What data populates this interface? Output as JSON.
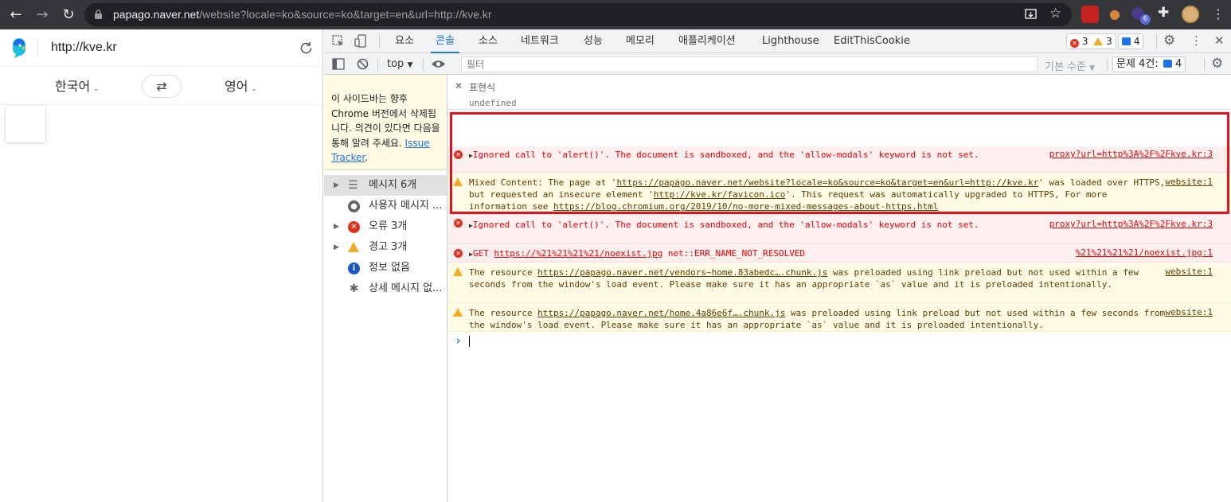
{
  "browser": {
    "url_host": "papago.naver.net",
    "url_path": "/website?locale=ko&source=ko&target=en&url=http://kve.kr",
    "extension_badge": "6"
  },
  "papago": {
    "url": "http://kve.kr",
    "source_lang": "한국어",
    "target_lang": "영어"
  },
  "devtools": {
    "tabs": [
      "요소",
      "콘솔",
      "소스",
      "네트워크",
      "성능",
      "메모리",
      "애플리케이션",
      "Lighthouse",
      "EditThisCookie"
    ],
    "active_tab": "콘솔",
    "counts": {
      "errors": "3",
      "warnings": "3",
      "messages": "4"
    },
    "toolbar": {
      "context": "top",
      "filter_placeholder": "필터",
      "level": "기본 수준",
      "issues_label": "문제 4건:",
      "issues_count": "4"
    },
    "deprecation": {
      "text": "이 사이드바는 향후 Chrome 버전에서 삭제됩니다. 의견이 있다면 다음을 통해 알려 주세요. ",
      "link": "Issue Tracker",
      "suffix": "."
    },
    "sidebar": [
      {
        "label": "메시지 6개",
        "icon": "list-icon"
      },
      {
        "label": "사용자 메시지 ...",
        "icon": "user-icon"
      },
      {
        "label": "오류 3개",
        "icon": "error-icon"
      },
      {
        "label": "경고 3개",
        "icon": "warning-icon"
      },
      {
        "label": "정보 없음",
        "icon": "info-icon"
      },
      {
        "label": "상세 메시지 없...",
        "icon": "bug-icon"
      }
    ],
    "expression": {
      "label": "표현식",
      "value": "undefined"
    },
    "messages": [
      {
        "level": "error",
        "text": "Ignored call to 'alert()'. The document is sandboxed, and the 'allow-modals' keyword is not set.",
        "source": "proxy?url=http%3A%2F%2Fkve.kr:3"
      },
      {
        "level": "warn",
        "text_a": "Mixed Content: The page at '",
        "link_a": "https://papago.naver.net/website?locale=ko&source=ko&target=en&url=http://kve.kr",
        "text_b": "' was loaded over HTTPS, but requested an insecure element '",
        "link_b": "http://kve.kr/favicon.ico",
        "text_c": "'. This request was automatically upgraded to HTTPS, For more information see ",
        "link_c": "https://blog.chromium.org/2019/10/no-more-mixed-messages-about-https.html",
        "source": "website:1"
      },
      {
        "level": "error",
        "text": "Ignored call to 'alert()'. The document is sandboxed, and the 'allow-modals' keyword is not set.",
        "source": "proxy?url=http%3A%2F%2Fkve.kr:3"
      },
      {
        "level": "error",
        "text_a": "GET ",
        "link_a": "https://%21%21%21%21/noexist.jpg",
        "text_b": " net::ERR_NAME_NOT_RESOLVED",
        "source": "%21%21%21%21/noexist.jpg:1"
      },
      {
        "level": "warn",
        "text_a": "The resource ",
        "link_a": "https://papago.naver.net/vendors~home.83abedc….chunk.js",
        "text_b": " was preloaded using link preload but not used within a few seconds from the window's load event. Please make sure it has an appropriate `as` value and it is preloaded intentionally.",
        "source": "website:1"
      },
      {
        "level": "warn",
        "text_a": "The resource ",
        "link_a": "https://papago.naver.net/home.4a86e6f….chunk.js",
        "text_b": " was preloaded using link preload but not used within a few seconds from the window's load event. Please make sure it has an appropriate `as` value and it is preloaded intentionally.",
        "source": "website:1"
      }
    ],
    "prompt": "›"
  }
}
